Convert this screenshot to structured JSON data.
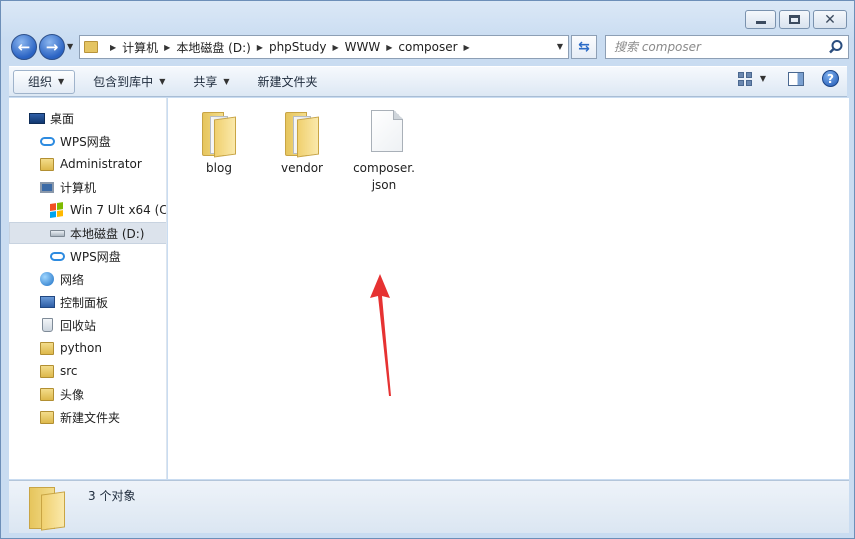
{
  "window": {
    "caption_buttons": [
      "minimize",
      "maximize",
      "close"
    ]
  },
  "address_bar": {
    "crumbs": [
      "计算机",
      "本地磁盘 (D:)",
      "phpStudy",
      "WWW",
      "composer"
    ]
  },
  "search": {
    "placeholder": "搜索 composer"
  },
  "toolbar": {
    "organize_label": "组织",
    "include_label": "包含到库中",
    "share_label": "共享",
    "new_folder_label": "新建文件夹"
  },
  "nav_pane": {
    "items": [
      {
        "label": "桌面",
        "icon": "desktop-icon"
      },
      {
        "label": "WPS网盘",
        "icon": "cloud-icon"
      },
      {
        "label": "Administrator",
        "icon": "user-folder-icon"
      },
      {
        "label": "计算机",
        "icon": "computer-icon"
      },
      {
        "label": "Win 7 Ult x64 (C:",
        "icon": "windows-drive-icon"
      },
      {
        "label": "本地磁盘 (D:)",
        "icon": "drive-icon",
        "selected": true
      },
      {
        "label": "WPS网盘",
        "icon": "cloud-icon"
      },
      {
        "label": "网络",
        "icon": "network-icon"
      },
      {
        "label": "控制面板",
        "icon": "control-panel-icon"
      },
      {
        "label": "回收站",
        "icon": "recycle-bin-icon"
      },
      {
        "label": "python",
        "icon": "folder-icon"
      },
      {
        "label": "src",
        "icon": "folder-icon"
      },
      {
        "label": "头像",
        "icon": "folder-icon"
      },
      {
        "label": "新建文件夹",
        "icon": "folder-icon"
      }
    ]
  },
  "content": {
    "files": [
      {
        "name": "blog",
        "type": "folder"
      },
      {
        "name": "vendor",
        "type": "folder"
      },
      {
        "name": "composer.\njson",
        "type": "file"
      }
    ]
  },
  "status": {
    "count_text": "3 个对象"
  },
  "colors": {
    "annotation_arrow": "#e63232",
    "selection": "#dce3ec",
    "chrome": "#c9dcf1"
  }
}
